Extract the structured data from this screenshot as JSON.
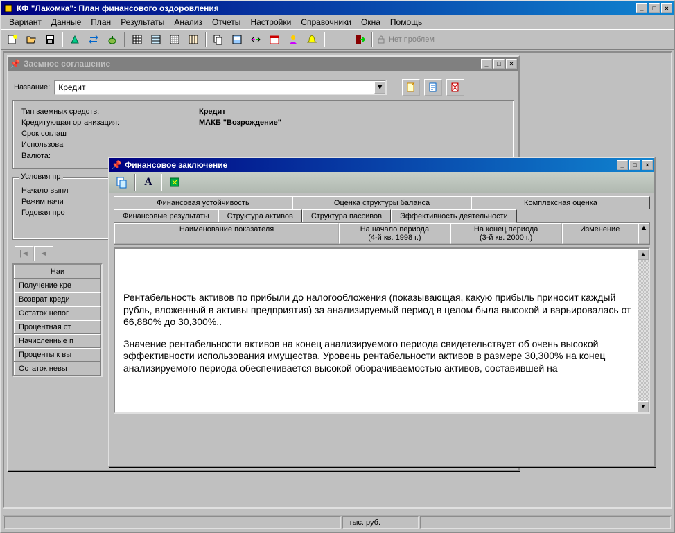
{
  "main_window": {
    "title": "КФ \"Лакомка\": План финансового оздоровления",
    "menu": [
      "Вариант",
      "Данные",
      "План",
      "Результаты",
      "Анализ",
      "Отчеты",
      "Настройки",
      "Справочники",
      "Окна",
      "Помощь"
    ],
    "menu_underline": [
      "В",
      "Д",
      "П",
      "Р",
      "А",
      "О",
      "Н",
      "С",
      "О",
      "П"
    ],
    "status_disabled": "Нет проблем"
  },
  "loan_window": {
    "title": "Заемное соглашение",
    "name_label": "Название:",
    "name_value": "Кредит",
    "fields": {
      "type_label": "Тип заемных средств:",
      "type_value": "Кредит",
      "org_label": "Кредитующая организация:",
      "org_value": "МАКБ \"Возрождение\"",
      "term_label": "Срок соглаш",
      "use_label": "Использова",
      "currency_label": "Валюта:"
    },
    "group_title": "Условия пр",
    "group_rows": [
      "Начало выпл",
      "Режим начи",
      "Годовая про"
    ],
    "table_header": "Наи",
    "table_rows": [
      "Получение кре",
      "Возврат креди",
      "Остаток непог",
      "Процентная ст",
      "Начисленные п",
      "Проценты к вы",
      "Остаток невы"
    ]
  },
  "fin_window": {
    "title": "Финансовое заключение",
    "tabs_row1": [
      "Финансовая устойчивость",
      "Оценка  структуры баланса",
      "Комплексная оценка"
    ],
    "tabs_row2": [
      "Финансовые результаты",
      "Структура активов",
      "Структура пассивов",
      "Эффективность деятельности"
    ],
    "active_tab": "Эффективность деятельности",
    "col_headers": {
      "name": "Наименование показателя",
      "start": "На начало периода",
      "start_sub": "(4-й кв. 1998 г.)",
      "end": "На конец периода",
      "end_sub": "(3-й кв. 2000 г.)",
      "change": "Изменение"
    },
    "body_p1": "Рентабельность активов по прибыли до налогообложения (показывающая, какую прибыль приносит каждый рубль, вложенный в активы предприятия) за анализируемый период в целом была высокой и варьировалась от 66,880% до 30,300%..",
    "body_p2": "Значение рентабельности активов на конец анализируемого периода свидетельствует об очень высокой эффективности использования имущества. Уровень рентабельности активов в размере 30,300% на конец анализируемого периода обеспечивается высокой оборачиваемостью активов, составившей на"
  },
  "statusbar": {
    "cell1": "тыс. руб."
  }
}
